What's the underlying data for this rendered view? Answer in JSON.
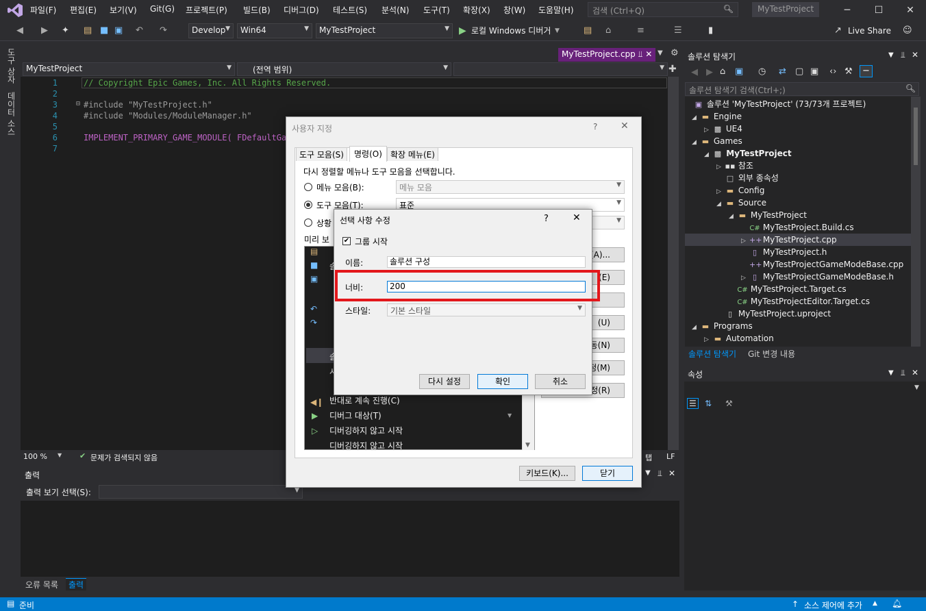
{
  "menu": [
    "파일(F)",
    "편집(E)",
    "보기(V)",
    "Git(G)",
    "프로젝트(P)",
    "빌드(B)",
    "디버그(D)",
    "테스트(S)",
    "분석(N)",
    "도구(T)",
    "확장(X)",
    "창(W)",
    "도움말(H)"
  ],
  "search": {
    "placeholder": "검색 (Ctrl+Q)"
  },
  "title": {
    "project": "MyTestProject"
  },
  "toolbar": {
    "config": "Develop",
    "platform": "Win64",
    "startup": "MyTestProject",
    "debugger": "로컬 Windows 디버거",
    "live_share": "Live Share"
  },
  "side_tabs": [
    "도구 상자",
    "데이터 소스"
  ],
  "editor": {
    "tab": "MyTestProject.cpp",
    "nav_project": "MyTestProject",
    "nav_scope": "(전역 범위)",
    "lines": [
      {
        "num": "1",
        "text": "// Copyright Epic Games, Inc. All Rights Reserved."
      },
      {
        "num": "2",
        "text": ""
      },
      {
        "num": "3",
        "text": "#include \"MyTestProject.h\""
      },
      {
        "num": "4",
        "text": "#include \"Modules/ModuleManager.h\""
      },
      {
        "num": "5",
        "text": ""
      },
      {
        "num": "6",
        "text": "IMPLEMENT_PRIMARY_GAME_MODULE( FDefaultGam"
      },
      {
        "num": "7",
        "text": ""
      }
    ],
    "zoom": "100 %",
    "issues": "문제가 검색되지 않음",
    "tab_label": "탭",
    "eol": "LF"
  },
  "output": {
    "title": "출력",
    "show_from": "출력 보기 선택(S):",
    "tabs": [
      "오류 목록",
      "출력"
    ]
  },
  "solution_explorer": {
    "title": "솔루션 탐색기",
    "search": "솔루션 탐색기 검색(Ctrl+;)",
    "items": [
      "솔루션 'MyTestProject' (73/73개 프로젝트)",
      "Engine",
      "UE4",
      "Games",
      "MyTestProject",
      "참조",
      "외부 종속성",
      "Config",
      "Source",
      "MyTestProject",
      "MyTestProject.Build.cs",
      "MyTestProject.cpp",
      "MyTestProject.h",
      "MyTestProjectGameModeBase.cpp",
      "MyTestProjectGameModeBase.h",
      "MyTestProject.Target.cs",
      "MyTestProjectEditor.Target.cs",
      "MyTestProject.uproject",
      "Programs",
      "Automation"
    ],
    "tabs": [
      "솔루션 탐색기",
      "Git 변경 내용"
    ]
  },
  "properties": {
    "title": "속성"
  },
  "status": {
    "ready": "준비",
    "source_control": "소스 제어에 추가"
  },
  "customize": {
    "title": "사용자 지정",
    "tabs": [
      "도구 모음(S)",
      "명령(O)",
      "확장 메뉴(E)"
    ],
    "instruction": "다시 정렬할 메뉴나 도구 모음을 선택합니다.",
    "menu_bar_label": "메뉴 모음(B):",
    "menu_bar_value": "메뉴 모음",
    "toolbar_label": "도구 모음(T):",
    "toolbar_value": "표준",
    "context_label": "상황",
    "preview_label": "미리 보",
    "preview_items": [
      "반대로 계속 진행(C)",
      "디버그 대상(T)",
      "디버깅하지 않고 시작",
      "디버깅하지 않고 시작"
    ],
    "preview_partial": [
      "솔",
      "솔",
      "시"
    ],
    "side_buttons": [
      "(A)...",
      "(E)",
      "",
      "(U)",
      "동(N)",
      "정(M)",
      "설정(R)"
    ],
    "keyboard": "키보드(K)...",
    "close": "닫기"
  },
  "modify": {
    "title": "선택 사항 수정",
    "begin_group": "그룹 시작",
    "name_label": "이름:",
    "name_value": "솔루션 구성",
    "width_label": "너비:",
    "width_value": "200",
    "style_label": "스타일:",
    "style_value": "기본 스타일",
    "reset": "다시 설정",
    "ok": "확인",
    "cancel": "취소"
  },
  "colors": {
    "accent": "#007acc",
    "doc_tab": "#68217a",
    "highlight": "#e3171b"
  }
}
